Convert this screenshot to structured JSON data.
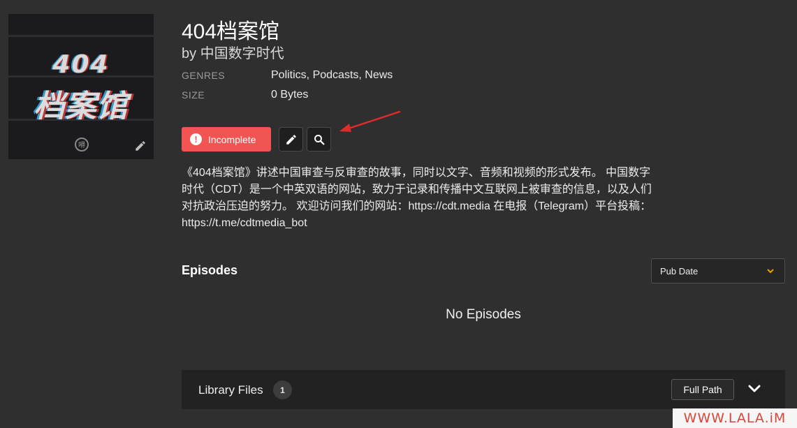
{
  "podcast": {
    "cover": {
      "line1": "404",
      "line2": "档案馆",
      "badge": "嘚",
      "edit_icon": "pencil-icon"
    },
    "title": "404档案馆",
    "author": "by 中国数字时代",
    "meta": [
      {
        "label": "GENRES",
        "value": "Politics, Podcasts, News"
      },
      {
        "label": "SIZE",
        "value": "0 Bytes"
      }
    ],
    "status": {
      "label": "Incomplete",
      "icon": "exclamation-icon",
      "color": "#f25454"
    },
    "actions": [
      {
        "icon": "pencil-icon"
      },
      {
        "icon": "search-icon"
      }
    ],
    "annotation_arrow_color": "#e02b2b",
    "description": "《404档案馆》讲述中国审查与反审查的故事，同时以文字、音频和视频的形式发布。 中国数字时代（CDT）是一个中英双语的网站，致力于记录和传播中文互联网上被审查的信息，以及人们对抗政治压迫的努力。 欢迎访问我们的网站：https://cdt.media 在电报（Telegram）平台投稿：https://t.me/cdtmedia_bot"
  },
  "episodes": {
    "heading": "Episodes",
    "sort": {
      "selected": "Pub Date",
      "icon": "chevron-down-icon",
      "chevron_color": "#f0a000"
    },
    "empty_text": "No Episodes"
  },
  "library": {
    "label": "Library Files",
    "count": "1",
    "full_path_label": "Full Path",
    "expand_icon": "chevron-down-icon"
  },
  "watermark": "WWW.LALA.iM"
}
